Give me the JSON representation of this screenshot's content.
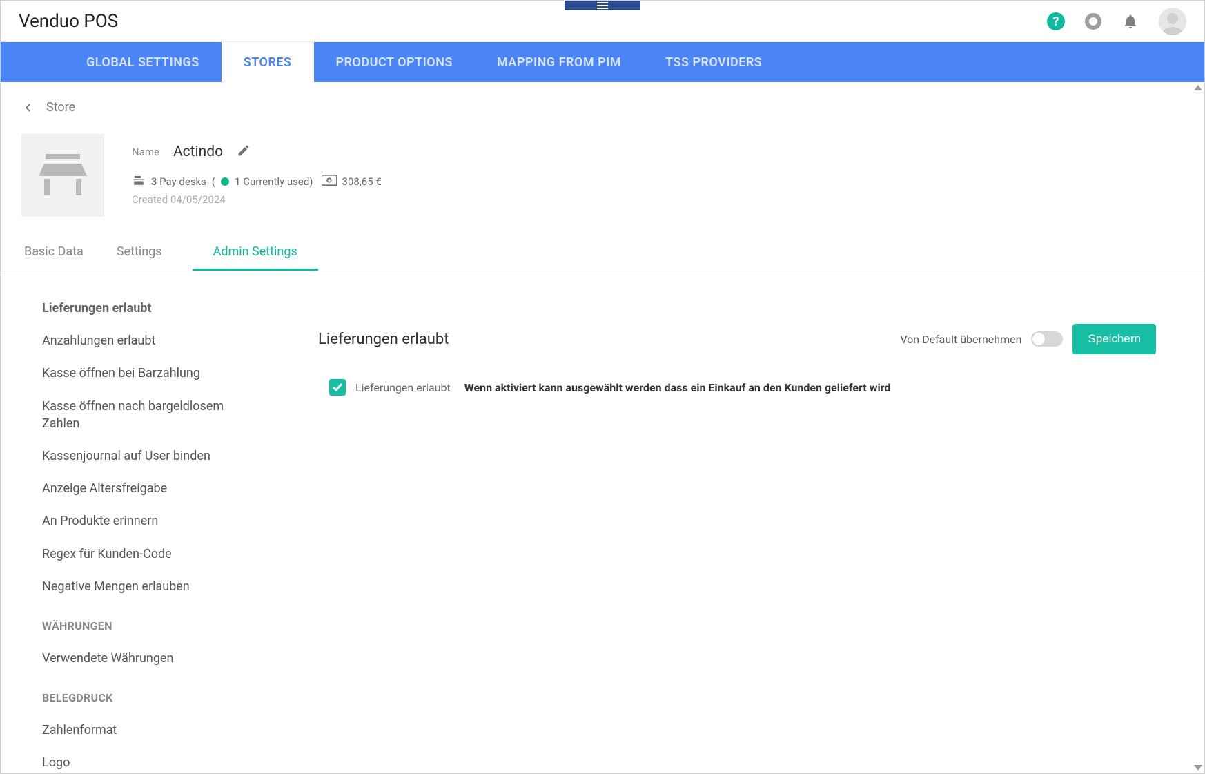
{
  "app_title": "Venduo POS",
  "primary_nav": [
    {
      "label": "GLOBAL SETTINGS",
      "active": false
    },
    {
      "label": "STORES",
      "active": true
    },
    {
      "label": "PRODUCT OPTIONS",
      "active": false
    },
    {
      "label": "MAPPING FROM PIM",
      "active": false
    },
    {
      "label": "TSS PROVIDERS",
      "active": false
    }
  ],
  "breadcrumb": {
    "label": "Store"
  },
  "store": {
    "name_label": "Name",
    "name_value": "Actindo",
    "paydesks_count": "3 Pay desks",
    "currently_used_prefix": "(",
    "currently_used": "1 Currently used)",
    "balance": "308,65 €",
    "created_label": "Created 04/05/2024"
  },
  "sub_tabs": [
    {
      "label": "Basic Data",
      "active": false
    },
    {
      "label": "Settings",
      "active": false
    },
    {
      "label": "Admin Settings",
      "active": true
    }
  ],
  "sidebar": {
    "items": [
      "Lieferungen erlaubt",
      "Anzahlungen erlaubt",
      "Kasse öffnen bei Barzahlung",
      "Kasse öffnen nach bargeldlosem Zahlen",
      "Kassenjournal auf User binden",
      "Anzeige Altersfreigabe",
      "An Produkte erinnern",
      "Regex für Kunden-Code",
      "Negative Mengen erlauben"
    ],
    "section2_heading": "WÄHRUNGEN",
    "section2_items": [
      "Verwendete Währungen"
    ],
    "section3_heading": "BELEGDRUCK",
    "section3_items": [
      "Zahlenformat",
      "Logo"
    ]
  },
  "main": {
    "title": "Lieferungen erlaubt",
    "default_toggle_label": "Von Default übernehmen",
    "save_label": "Speichern",
    "checkbox_label": "Lieferungen erlaubt",
    "checkbox_desc": "Wenn aktiviert kann ausgewählt werden dass ein Einkauf an den Kunden geliefert wird"
  }
}
